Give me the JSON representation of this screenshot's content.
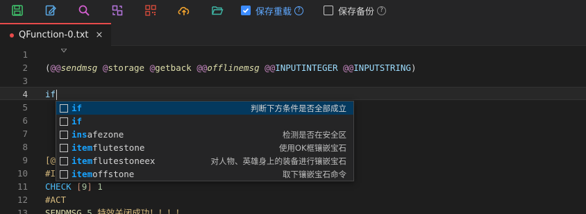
{
  "toolbar": {
    "icons": [
      {
        "name": "save-icon",
        "color": "#3fc06a"
      },
      {
        "name": "edit-icon",
        "color": "#5aa9e6"
      },
      {
        "name": "search-icon",
        "color": "#d55fd1"
      },
      {
        "name": "replace-icon",
        "color": "#b777e0"
      },
      {
        "name": "qrcode-icon",
        "color": "#d24a3a"
      },
      {
        "name": "cloud-upload-icon",
        "color": "#f0a22e"
      },
      {
        "name": "folder-open-icon",
        "color": "#3fb9a8"
      }
    ],
    "save_reload": {
      "label": "保存重载",
      "checked": true,
      "help": "?"
    },
    "save_backup": {
      "label": "保存备份",
      "checked": false,
      "help": "?"
    }
  },
  "tab": {
    "filename": "QFunction-0.txt",
    "close": "×",
    "modified": true
  },
  "editor": {
    "current_line": 4,
    "lines": [
      {
        "n": "1",
        "text": ""
      },
      {
        "n": "2",
        "text": "(@@sendmsg @storage @getback @@offlinemsg @@INPUTINTEGER @@INPUTSTRING)"
      },
      {
        "n": "3",
        "text": ""
      },
      {
        "n": "4",
        "text": "if"
      },
      {
        "n": "5",
        "text": ""
      },
      {
        "n": "6",
        "text": ""
      },
      {
        "n": "7",
        "text": ""
      },
      {
        "n": "8",
        "text": ""
      },
      {
        "n": "9",
        "text": "[@"
      },
      {
        "n": "10",
        "text": "#I"
      },
      {
        "n": "11",
        "text": "CHECK [9] 1"
      },
      {
        "n": "12",
        "text": "#ACT"
      },
      {
        "n": "13",
        "text": "SENDMSG 5 特效关闭成功！！！！"
      }
    ]
  },
  "suggestions": [
    {
      "match": "if",
      "rest": "",
      "desc": "判断下方条件是否全部成立",
      "selected": true
    },
    {
      "match": "if",
      "rest": "",
      "desc": "",
      "selected": false
    },
    {
      "match": "ins",
      "rest": "afezone",
      "desc": "检测是否在安全区",
      "selected": false,
      "parts": [
        "i",
        "n",
        "s",
        "a",
        "f",
        "ezone"
      ]
    },
    {
      "match": "item",
      "rest": "flutestone",
      "desc": "使用OK框镶嵌宝石",
      "selected": false
    },
    {
      "match": "item",
      "rest": "flutestoneex",
      "desc": "对人物、英雄身上的装备进行镶嵌宝石",
      "selected": false
    },
    {
      "match": "item",
      "rest": "offstone",
      "desc": "取下镶嵌宝石命令",
      "selected": false
    }
  ]
}
